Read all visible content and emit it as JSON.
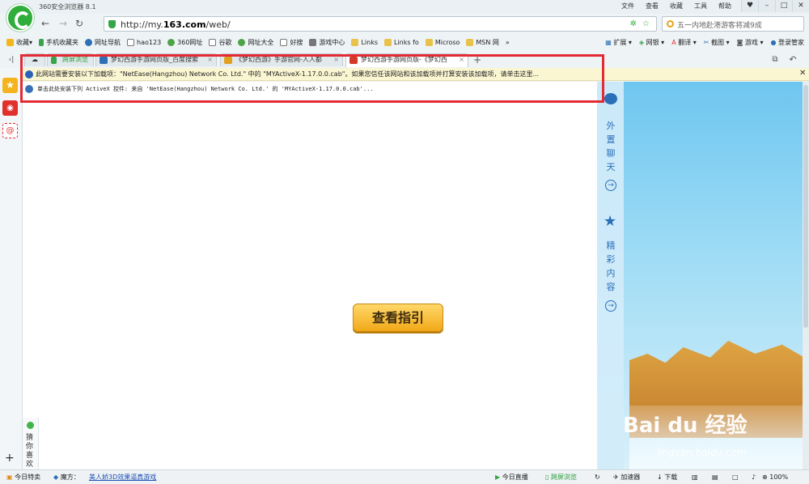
{
  "app": {
    "title": "360安全浏览器 8.1",
    "menu": [
      "文件",
      "查看",
      "收藏",
      "工具",
      "帮助"
    ]
  },
  "nav": {
    "url_prefix": "http://my.",
    "url_domain": "163.com",
    "url_suffix": "/web/",
    "search_placeholder": "五一内地赴港游客将减9成"
  },
  "bookmarks": {
    "items": [
      "收藏",
      "手机收藏夹",
      "网址导航",
      "hao123",
      "360网址",
      "谷歌",
      "网址大全",
      "好搜",
      "游戏中心",
      "Links",
      "Links fo",
      "Microso",
      "MSN 网"
    ],
    "more": "»",
    "right": [
      "扩展",
      "网银",
      "翻译",
      "截图",
      "游戏",
      "登录管家"
    ]
  },
  "tabs": [
    {
      "label": "跨屏浏览"
    },
    {
      "label": "梦幻西游手游网页版_百度搜索"
    },
    {
      "label": "《梦幻西游》手游官网-人人都"
    },
    {
      "label": "梦幻西游手游网页版-《梦幻西"
    }
  ],
  "infobar": {
    "message": "此网站需要安装以下加载项：\"NetEase(Hangzhou) Network Co. Ltd.\" 中的 \"MYActiveX-1.17.0.0.cab\"。如果您信任该网站和该加载项并打算安装该加载项，请单击这里...",
    "activex": "单击此处安装下列 ActiveX 控件: 来自 'NetEase(Hangzhou) Network Co. Ltd.' 的 'MYActiveX-1.17.0.0.cab'..."
  },
  "page": {
    "guide_button": "查看指引"
  },
  "side_panel": {
    "chat_label": "外置聊天",
    "featured_label": "精彩内容"
  },
  "like_box": {
    "label": "猜你喜欢"
  },
  "watermark": {
    "text": "Bai du 经验",
    "url": "jingyan.baidu.com"
  },
  "status": {
    "left": [
      "今日特卖",
      "魔方："
    ],
    "link": "美人娇3D效果逼真游戏",
    "right": [
      "今日直播",
      "跨屏浏览",
      "加速器",
      "下载",
      "100%"
    ]
  },
  "colors": {
    "highlight": "#e32a35",
    "brand": "#2fae3c",
    "button": "#f2a818"
  }
}
